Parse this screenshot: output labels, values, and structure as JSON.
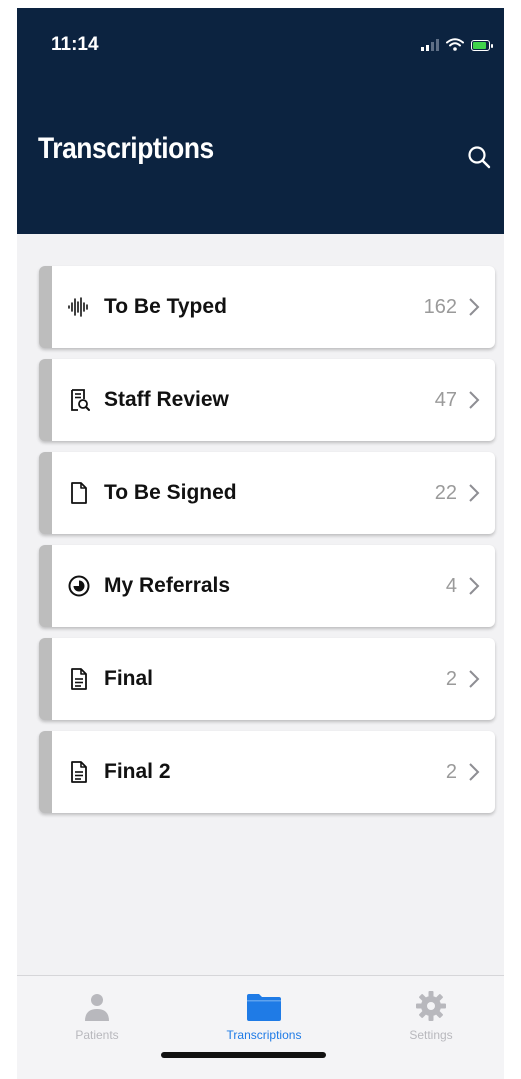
{
  "status_bar": {
    "time": "11:14"
  },
  "header": {
    "title": "Transcriptions",
    "search_icon": "search-icon"
  },
  "categories": [
    {
      "icon": "waveform-icon",
      "label": "To Be Typed",
      "count": "162"
    },
    {
      "icon": "document-search-icon",
      "label": "Staff Review",
      "count": "47"
    },
    {
      "icon": "document-icon",
      "label": "To Be Signed",
      "count": "22"
    },
    {
      "icon": "pie-chart-icon",
      "label": "My Referrals",
      "count": "4"
    },
    {
      "icon": "document-lines-icon",
      "label": "Final",
      "count": "2"
    },
    {
      "icon": "document-lines-icon",
      "label": "Final 2",
      "count": "2"
    }
  ],
  "tabbar": {
    "tabs": [
      {
        "icon": "person-icon",
        "label": "Patients",
        "active": false
      },
      {
        "icon": "folder-icon",
        "label": "Transcriptions",
        "active": true
      },
      {
        "icon": "gear-icon",
        "label": "Settings",
        "active": false
      }
    ]
  },
  "colors": {
    "header_bg": "#0c2340",
    "accent": "#1f7be6",
    "card_stripe": "#bdbdbd",
    "background": "#f2f2f4"
  }
}
